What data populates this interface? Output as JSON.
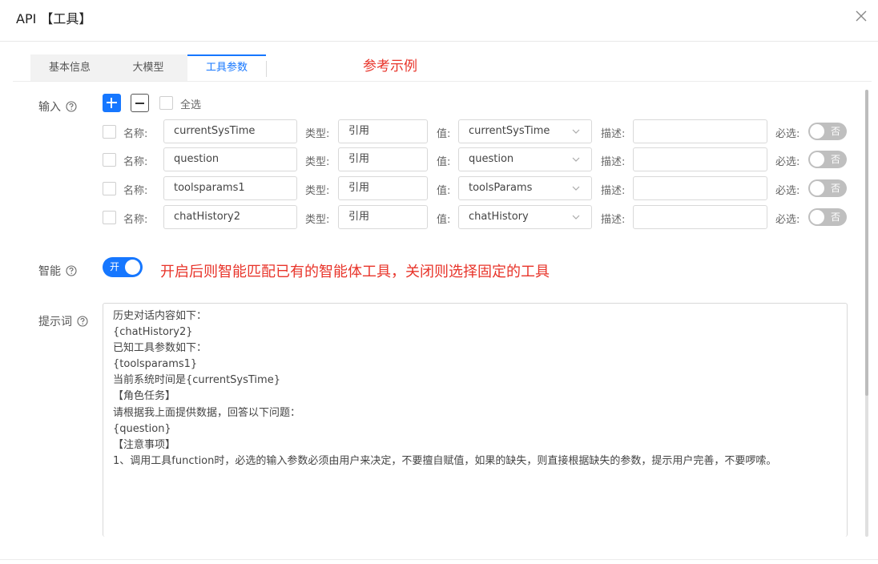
{
  "dialog": {
    "title": "API 【工具】"
  },
  "tabs": [
    {
      "label": "基本信息"
    },
    {
      "label": "大模型"
    },
    {
      "label": "工具参数"
    }
  ],
  "annotations": {
    "example": "参考示例",
    "smart": "开启后则智能匹配已有的智能体工具，关闭则选择固定的工具"
  },
  "input_section": {
    "label": "输入",
    "select_all": "全选",
    "name_label": "名称:",
    "type_label": "类型:",
    "value_label": "值:",
    "desc_label": "描述:",
    "required_label": "必选:",
    "rows": [
      {
        "name": "currentSysTime",
        "type": "引用",
        "value": "currentSysTime",
        "desc": "",
        "required": "否"
      },
      {
        "name": "question",
        "type": "引用",
        "value": "question",
        "desc": "",
        "required": "否"
      },
      {
        "name": "toolsparams1",
        "type": "引用",
        "value": "toolsParams",
        "desc": "",
        "required": "否"
      },
      {
        "name": "chatHistory2",
        "type": "引用",
        "value": "chatHistory",
        "desc": "",
        "required": "否"
      }
    ]
  },
  "smart_section": {
    "label": "智能",
    "toggle_text": "开"
  },
  "prompt_section": {
    "label": "提示词",
    "lines": [
      "历史对话内容如下：",
      "{chatHistory2}",
      "已知工具参数如下：",
      "{toolsparams1}",
      "当前系统时间是{currentSysTime}",
      "【角色任务】",
      "请根据我上面提供数据，回答以下问题：",
      "{question}",
      "【注意事项】",
      "1、调用工具function时，必选的输入参数必须由用户来决定，不要擅自赋值，如果的缺失，则直接根据缺失的参数，提示用户完善，不要啰嗦。"
    ]
  },
  "colors": {
    "accent": "#1677ff",
    "annotation": "#e8342a",
    "toggle_off": "#bfbfbf"
  }
}
